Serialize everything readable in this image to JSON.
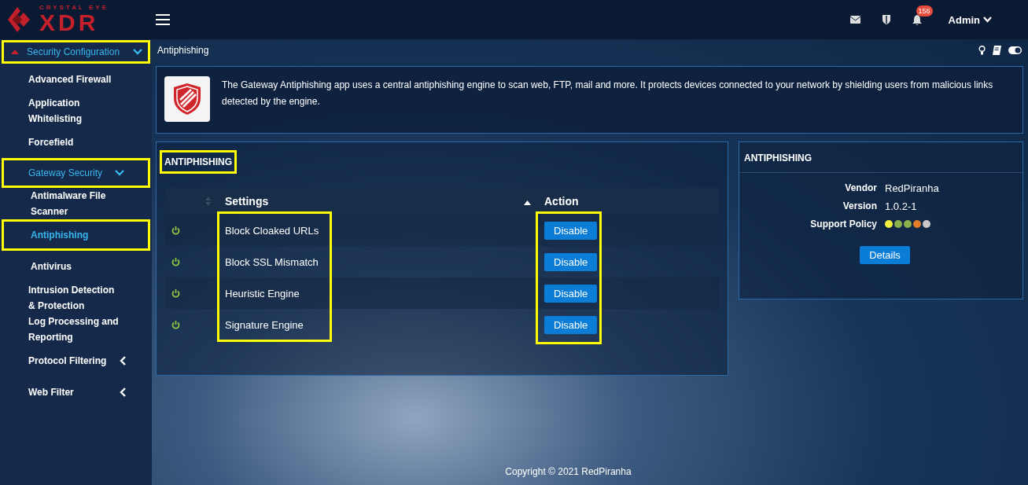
{
  "brand": {
    "tagline": "CRYSTAL EYE",
    "name": "XDR"
  },
  "topbar": {
    "notification_count": "156",
    "user": "Admin"
  },
  "sidebar": {
    "section": {
      "label": "Security Configuration",
      "expanded": true,
      "highlighted": true
    },
    "items": [
      {
        "label": "Advanced Firewall",
        "highlighted": false
      },
      {
        "label": "Application Whitelisting",
        "highlighted": false
      },
      {
        "label": "Forcefield",
        "highlighted": false
      },
      {
        "label": "Gateway Security",
        "expanded": true,
        "highlighted": true,
        "children": [
          {
            "label": "Antimalware File Scanner",
            "selected": false,
            "highlighted": false
          },
          {
            "label": "Antiphishing",
            "selected": true,
            "highlighted": true
          },
          {
            "label": "Antivirus",
            "selected": false,
            "highlighted": false
          }
        ]
      },
      {
        "label": "Intrusion Detection & Protection",
        "highlighted": false
      },
      {
        "label": "Log Processing and Reporting",
        "highlighted": false
      },
      {
        "label": "Protocol Filtering",
        "expanded": false,
        "highlighted": false
      },
      {
        "label": "Web Filter",
        "expanded": false,
        "highlighted": false
      }
    ]
  },
  "page_title": "Antiphishing",
  "intro": "The Gateway Antiphishing app uses a central antiphishing engine to scan web, FTP, mail and more. It protects devices connected to your network by shielding users from malicious links detected by the engine.",
  "settings_panel": {
    "title": "ANTIPHISHING",
    "title_highlighted": true,
    "columns": [
      "Settings",
      "Action"
    ],
    "settings_highlighted": true,
    "action_highlighted": true,
    "rows": [
      {
        "setting": "Block Cloaked URLs",
        "enabled": true,
        "action": "Disable"
      },
      {
        "setting": "Block SSL Mismatch",
        "enabled": true,
        "action": "Disable"
      },
      {
        "setting": "Heuristic Engine",
        "enabled": true,
        "action": "Disable"
      },
      {
        "setting": "Signature Engine",
        "enabled": true,
        "action": "Disable"
      }
    ]
  },
  "info_panel": {
    "title": "ANTIPHISHING",
    "fields": [
      {
        "label": "Vendor",
        "value": "RedPiranha"
      },
      {
        "label": "Version",
        "value": "1.0.2-1"
      }
    ],
    "support_policy": {
      "label": "Support Policy",
      "dots": [
        {
          "color": "#f5ef3d"
        },
        {
          "color": "#8db04f"
        },
        {
          "color": "#8db04f"
        },
        {
          "color": "#e07c2a"
        },
        {
          "color": "#c8c8c8"
        }
      ]
    },
    "button": "Details"
  },
  "footer": "Copyright © 2021 RedPiranha"
}
